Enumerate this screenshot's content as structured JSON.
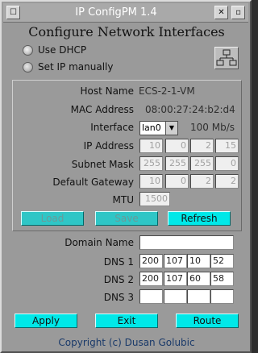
{
  "window": {
    "title": "IP ConfigPM 1.4",
    "heading": "Configure Network Interfaces",
    "sysmenu_glyph": "☐",
    "close_glyph": "✕",
    "min_glyph": "▫"
  },
  "mode": {
    "dhcp_label": "Use DHCP",
    "manual_label": "Set IP manually",
    "selected": "dhcp"
  },
  "info": {
    "host_label": "Host Name",
    "host_value": "ECS-2-1-VM",
    "mac_label": "MAC Address",
    "mac_value": "08:00:27:24:b2:d4",
    "iface_label": "Interface",
    "iface_value": "lan0",
    "iface_speed": "100 Mb/s"
  },
  "ip": {
    "label": "IP Address",
    "octets": [
      "10",
      "0",
      "2",
      "15"
    ]
  },
  "mask": {
    "label": "Subnet Mask",
    "octets": [
      "255",
      "255",
      "255",
      "0"
    ]
  },
  "gateway": {
    "label": "Default Gateway",
    "octets": [
      "10",
      "0",
      "2",
      "2"
    ]
  },
  "mtu": {
    "label": "MTU",
    "value": "1500"
  },
  "panel_buttons": {
    "load": "Load",
    "save": "Save",
    "refresh": "Refresh"
  },
  "domain": {
    "label": "Domain Name",
    "value": ""
  },
  "dns1": {
    "label": "DNS 1",
    "octets": [
      "200",
      "107",
      "10",
      "52"
    ]
  },
  "dns2": {
    "label": "DNS 2",
    "octets": [
      "200",
      "107",
      "60",
      "58"
    ]
  },
  "dns3": {
    "label": "DNS 3",
    "octets": [
      "",
      "",
      "",
      ""
    ]
  },
  "actions": {
    "apply": "Apply",
    "exit": "Exit",
    "route": "Route"
  },
  "copyright": "Copyright (c) Dusan Golubic",
  "colors": {
    "window_bg": "#9a9a9a",
    "button_accent": "#00e8e8",
    "copyright_text": "#1a3a6a"
  }
}
